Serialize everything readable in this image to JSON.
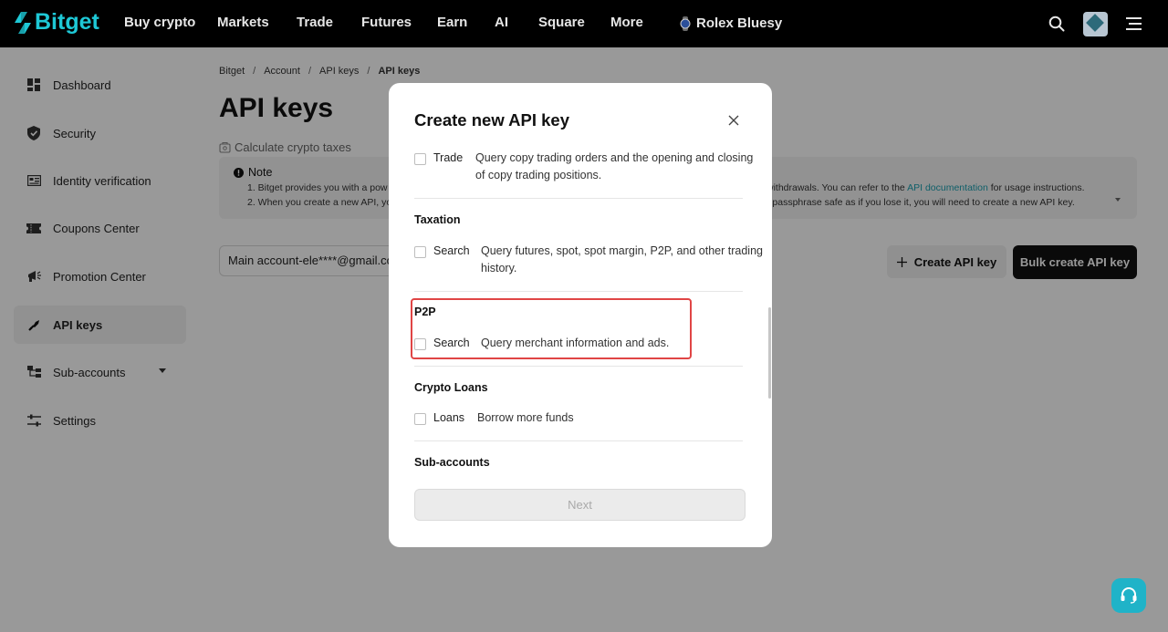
{
  "brand": {
    "name": "Bitget",
    "accent": "#1ec8d6"
  },
  "nav": {
    "items": [
      "Buy crypto",
      "Markets",
      "Trade",
      "Futures",
      "Earn",
      "AI",
      "Square",
      "More",
      "Rolex Bluesy"
    ]
  },
  "sidebar": {
    "items": [
      {
        "label": "Dashboard",
        "icon": "dashboard-icon"
      },
      {
        "label": "Security",
        "icon": "shield-icon"
      },
      {
        "label": "Identity verification",
        "icon": "id-card-icon"
      },
      {
        "label": "Coupons Center",
        "icon": "coupon-icon"
      },
      {
        "label": "Promotion Center",
        "icon": "megaphone-icon"
      },
      {
        "label": "API keys",
        "icon": "api-key-icon"
      },
      {
        "label": "Sub-accounts",
        "icon": "sub-accounts-icon"
      },
      {
        "label": "Settings",
        "icon": "sliders-icon"
      }
    ]
  },
  "breadcrumb": {
    "items": [
      "Bitget",
      "Account",
      "API keys",
      "API keys"
    ],
    "separator": "/"
  },
  "page": {
    "title": "API keys",
    "calc_link": "Calculate crypto taxes",
    "note": {
      "title": "Note",
      "line1_start": "1.  Bitget provides you with a pow",
      "line1_end": "withdrawals. You can refer to the",
      "line1_link": "API documentation",
      "line1_tail": "for usage instructions.",
      "line2_start": "2.  When you create a new API, yo",
      "line2_end": "r passphrase safe as if you lose it, you will need to create a new API key."
    },
    "account_select": "Main account-ele****@gmail.com",
    "create_button": "Create API key",
    "bulk_button": "Bulk create API key"
  },
  "modal": {
    "title": "Create new API key",
    "trade_row": {
      "label": "Trade",
      "desc_line1": "Query copy trading orders and the opening and closing",
      "desc_line2": "of copy trading positions."
    },
    "groups": {
      "taxation": {
        "title": "Taxation",
        "label": "Search",
        "desc_line1": "Query futures, spot, spot margin, P2P, and other trading",
        "desc_line2": "history."
      },
      "p2p": {
        "title": "P2P",
        "label": "Search",
        "desc": "Query merchant information and ads."
      },
      "crypto_loans": {
        "title": "Crypto Loans",
        "label": "Loans",
        "desc": "Borrow more funds"
      },
      "sub_accounts": {
        "title": "Sub-accounts"
      }
    },
    "next_button": "Next",
    "highlight_color": "#e04545"
  }
}
